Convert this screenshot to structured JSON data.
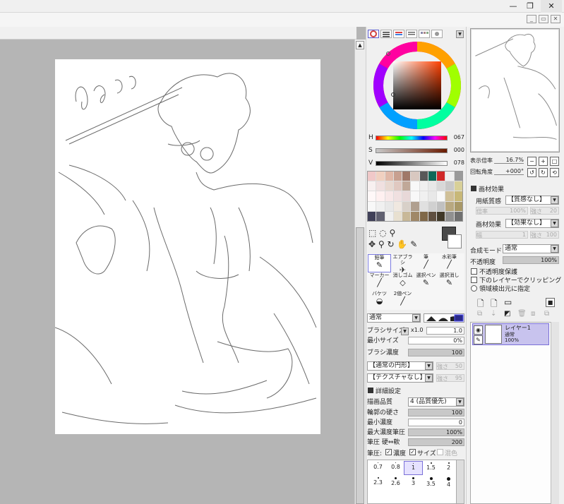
{
  "window": {
    "controls": [
      "—",
      "❐",
      "✕"
    ],
    "inner_controls": [
      "_",
      "▭",
      "✕"
    ]
  },
  "color_panel": {
    "h_label": "H",
    "h_value": "067",
    "s_label": "S",
    "s_value": "000",
    "v_label": "V",
    "v_value": "078"
  },
  "swatches": [
    "#f0c8c8",
    "#f0d0c0",
    "#e0b8a8",
    "#c8a090",
    "#a07868",
    "#d8c8c0",
    "#585858",
    "#106858",
    "#d02828",
    "#f0f0f0",
    "#9a9a9a",
    "#f8f0f0",
    "#f0e0e0",
    "#e8d8d0",
    "#e0c8c0",
    "#c0a898",
    "#f8f8f8",
    "#f0f0f0",
    "#e8e8e8",
    "#d8d8d8",
    "#c8c8c8",
    "#d8d098",
    "#fff8f8",
    "#fff0f0",
    "#f8e8e8",
    "#f0e0e0",
    "#e8d8d8",
    "#f8f8f8",
    "#f0f0f0",
    "#e8e8e8",
    "#f8f8f8",
    "#d0c098",
    "#c8b878",
    "#f8f8f8",
    "#f0f0f0",
    "#e8e8e8",
    "#f0e8e0",
    "#d8d0c8",
    "#b0a090",
    "#e0e0e0",
    "#d0d0d0",
    "#c0c0c0",
    "#b8a880",
    "#a89868",
    "#404058",
    "#606070",
    "#f0f0f0",
    "#e8e0d0",
    "#c8b898",
    "#a08868",
    "#806848",
    "#605040",
    "#403828",
    "#909090",
    "#707070"
  ],
  "tools": {
    "row1": [
      {
        "label": "鉛筆",
        "icon": "✎",
        "name": "pencil"
      },
      {
        "label": "エアブラシ",
        "icon": "✈",
        "name": "airbrush"
      },
      {
        "label": "筆",
        "icon": "╱",
        "name": "brush"
      },
      {
        "label": "水彩筆",
        "icon": "╱",
        "name": "watercolor"
      }
    ],
    "row2": [
      {
        "label": "マーカー",
        "icon": "╱",
        "name": "marker"
      },
      {
        "label": "消しゴム",
        "icon": "◇",
        "name": "eraser"
      },
      {
        "label": "選択ペン",
        "icon": "✎",
        "name": "select-pen"
      },
      {
        "label": "選択消し",
        "icon": "✎",
        "name": "select-eraser"
      }
    ],
    "row3": [
      {
        "label": "バケツ",
        "icon": "◒",
        "name": "bucket"
      },
      {
        "label": "2値ペン",
        "icon": "╱",
        "name": "binary-pen"
      }
    ]
  },
  "brush": {
    "blend_mode": "通常",
    "size_label": "ブラシサイズ",
    "size_multiplier": "x1.0",
    "size_value": "1.0",
    "min_size_label": "最小サイズ",
    "min_size_value": "0%",
    "density_label": "ブラシ濃度",
    "density_value": "100",
    "shape": "【通常の円形】",
    "shape_strength": "強さ",
    "shape_strength_value": "50",
    "texture": "【テクスチャなし】",
    "texture_strength": "強さ",
    "texture_strength_value": "95",
    "details_label": "詳細設定",
    "quality_label": "描画品質",
    "quality_value": "4 (品質優先)",
    "edge_label": "輪郭の硬さ",
    "edge_value": "100",
    "min_density_label": "最小濃度",
    "min_density_value": "0",
    "max_density_pressure_label": "最大濃度筆圧",
    "max_density_pressure_value": "100%",
    "pressure_label": "筆圧 硬⇔軟",
    "pressure_value": "200",
    "pressure_opts_label": "筆圧:",
    "opt_density": "濃度",
    "opt_size": "サイズ",
    "opt_mix": "混色"
  },
  "sizes": [
    [
      "0.7",
      "0.8",
      "1",
      "1.5",
      "2"
    ],
    [
      "2.3",
      "2.6",
      "3",
      "3.5",
      "4"
    ]
  ],
  "navigator": {
    "zoom_label": "表示倍率",
    "zoom_value": "16.7%",
    "rotate_label": "回転角度",
    "rotate_value": "+000°"
  },
  "paper": {
    "section": "画材効果",
    "paper_label": "用紙質感",
    "paper_value": "【質感なし】",
    "paper_scale": "倍率",
    "paper_scale_value": "100%",
    "paper_strength": "強さ",
    "paper_strength_value": "20",
    "effect_label": "画材効果",
    "effect_value": "【効果なし】",
    "effect_width": "幅",
    "effect_width_value": "1",
    "effect_strength": "強さ",
    "effect_strength_value": "100"
  },
  "layer_props": {
    "blend_label": "合成モード",
    "blend_value": "通常",
    "opacity_label": "不透明度",
    "opacity_value": "100%",
    "protect_opacity": "不透明度保護",
    "clip_below": "下のレイヤーでクリッピング",
    "region_detect": "領域検出元に指定"
  },
  "layers": [
    {
      "name": "レイヤー1",
      "mode": "通常",
      "opacity": "100%"
    }
  ]
}
